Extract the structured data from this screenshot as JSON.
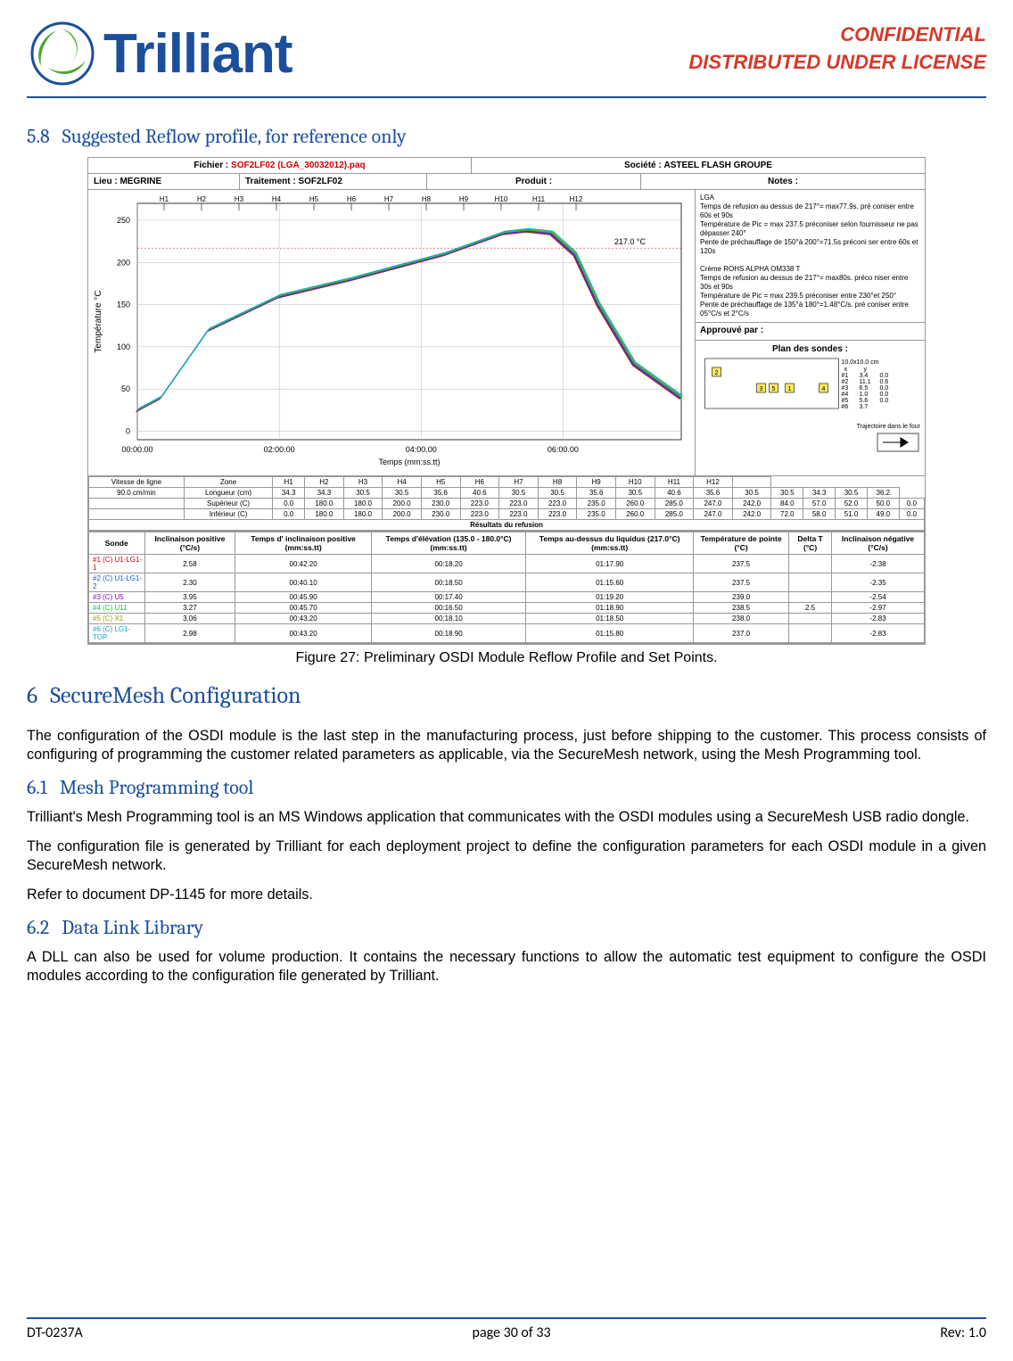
{
  "header": {
    "brand": "Trilliant",
    "conf1": "CONFIDENTIAL",
    "conf2": "DISTRIBUTED UNDER LICENSE"
  },
  "section58": {
    "num": "5.8",
    "title": "Suggested Reflow profile, for reference only"
  },
  "figcaption": "Figure 27: Preliminary OSDI Module Reflow Profile and Set Points.",
  "section6": {
    "num": "6",
    "title": "SecureMesh Configuration"
  },
  "p6": "The configuration of the OSDI module is the last step in the manufacturing process, just before shipping to the customer. This process consists of configuring of programming the customer related parameters as applicable, via the SecureMesh network, using the Mesh Programming tool.",
  "section61": {
    "num": "6.1",
    "title": "Mesh Programming tool"
  },
  "p61a": "Trilliant's Mesh Programming tool is an MS Windows application that communicates with the OSDI modules using a SecureMesh USB radio dongle.",
  "p61b": "The configuration file is generated by Trilliant for each deployment project to define the configuration parameters for each OSDI module in a given SecureMesh network.",
  "p61c": "Refer to document DP-1145 for more details.",
  "section62": {
    "num": "6.2",
    "title": "Data Link Library"
  },
  "p62": "A DLL can also be used for volume production. It contains the necessary functions to allow the automatic test equipment to configure the OSDI modules according to the configuration file generated by Trilliant.",
  "footer": {
    "doc": "DT-0237A",
    "page": "page 30 of 33",
    "rev": "Rev: 1.0"
  },
  "chart_data": {
    "type": "line",
    "title_row1": {
      "fichier_label": "Fichier :",
      "fichier": "SOF2LF02 (LGA_30032012).paq",
      "societe_label": "Société :",
      "societe": "ASTEEL FLASH GROUPE"
    },
    "title_row2": {
      "lieu_label": "Lieu :",
      "lieu": "MEGRINE",
      "trait_label": "Traitement :",
      "trait": "SOF2LF02",
      "produit_label": "Produit :",
      "produit": "",
      "notes_label": "Notes :"
    },
    "ylabel": "Température °C",
    "xlabel": "Temps (mm:ss.tt)",
    "y_ticks": [
      0,
      50,
      100,
      150,
      200,
      250
    ],
    "x_ticks": [
      "00:00.00",
      "02:00.00",
      "04:00.00",
      "06:00.00"
    ],
    "zones": [
      "H1",
      "H2",
      "H3",
      "H4",
      "H5",
      "H6",
      "H7",
      "H8",
      "H9",
      "H10",
      "H11",
      "H12"
    ],
    "annotation": "217.0 °C",
    "notes_text": [
      "LGA",
      "Temps de refusion au dessus de 217°= max77.9s. pré coniser entre 60s et 90s",
      "Température de Pic = max 237.5 préconiser selon fournisseur ne pas dépasser 240°",
      "Pente de préchauffage de 150°à 200°=71.5s préconi ser entre 60s et 120s",
      "",
      "Crème ROHS ALPHA OM338 T",
      "Temps de refusion au dessus de 217°= max80s. préco niser entre 30s et 90s",
      "Température de Pic = max 239.5 préconiser entre 230°et 250°",
      "Pente de préchauffage de 135°à 180°=1.48°C/s. pré coniser entre 05°C/s et 2°C/s"
    ],
    "approve_label": "Approuvé par :",
    "plan_label": "Plan des sondes :",
    "plan_dim": "10.0x10.0 cm",
    "plan_table": [
      [
        "#1",
        "3.4",
        "0.0"
      ],
      [
        "#2",
        "11.1",
        "0.6"
      ],
      [
        "#3",
        "6.5",
        "0.0"
      ],
      [
        "#4",
        "1.0",
        "0.0"
      ],
      [
        "#5",
        "5.6",
        "0.0"
      ],
      [
        "#6",
        "3.7",
        ""
      ]
    ],
    "traj_label": "Trajectoire dans le four",
    "series": [
      {
        "name": "#1 (C) U1-LG1-1",
        "color": "#d40000"
      },
      {
        "name": "#2 (C) U1-LG1-2",
        "color": "#0066d4"
      },
      {
        "name": "#3 (C) U5",
        "color": "#9000d4"
      },
      {
        "name": "#4 (C) U11",
        "color": "#00d42a"
      },
      {
        "name": "#5 (C) X1",
        "color": "#9aa000"
      },
      {
        "name": "#6 (C) LG1-TOP",
        "color": "#00b0d4"
      }
    ],
    "profile_x": [
      0,
      20,
      60,
      120,
      180,
      220,
      260,
      290,
      310,
      330,
      350,
      370,
      390,
      420,
      460
    ],
    "profile_y": [
      25,
      40,
      120,
      160,
      180,
      195,
      210,
      225,
      235,
      238,
      235,
      210,
      150,
      80,
      40
    ],
    "zone_table": {
      "header": [
        "Vitesse de ligne",
        "Zone",
        "H1",
        "H2",
        "H3",
        "H4",
        "H5",
        "H6",
        "H7",
        "H8",
        "H9",
        "H10",
        "H11",
        "H12",
        ""
      ],
      "rows": [
        [
          "90.0 cm/min",
          "Longueur (cm)",
          "34.3",
          "34.3",
          "30.5",
          "30.5",
          "35.6",
          "40.6",
          "30.5",
          "30.5",
          "35.6",
          "30.5",
          "40.6",
          "35.6",
          "30.5",
          "30.5",
          "34.3",
          "30.5",
          "36.2"
        ],
        [
          "",
          "Supérieur (C)",
          "0.0",
          "180.0",
          "180.0",
          "200.0",
          "230.0",
          "223.0",
          "223.0",
          "223.0",
          "235.0",
          "260.0",
          "285.0",
          "247.0",
          "242.0",
          "84.0",
          "57.0",
          "52.0",
          "50.0",
          "0.0"
        ],
        [
          "",
          "Inférieur (C)",
          "0.0",
          "180.0",
          "180.0",
          "200.0",
          "230.0",
          "223.0",
          "223.0",
          "223.0",
          "235.0",
          "260.0",
          "285.0",
          "247.0",
          "242.0",
          "72.0",
          "58.0",
          "51.0",
          "49.0",
          "0.0"
        ]
      ],
      "results_title": "Résultats du refusion"
    },
    "results": {
      "headers": [
        "Sonde",
        "Inclinaison positive (°C/s)",
        "Temps d' inclinaison positive (mm:ss.tt)",
        "Temps d'élévation (135.0 - 180.0°C) (mm:ss.tt)",
        "Temps au-dessus du liquidus (217.0°C) (mm:ss.tt)",
        "Température de pointe (°C)",
        "Delta T (°C)",
        "Inclinaison négative (°C/s)"
      ],
      "rows": [
        [
          "#1 (C) U1-LG1-1",
          "2.58",
          "00:42.20",
          "00:18.20",
          "01:17.90",
          "237.5",
          "",
          "-2.38"
        ],
        [
          "#2 (C) U1-LG1-2",
          "2.30",
          "00:40.10",
          "00:18.50",
          "01:15.60",
          "237.5",
          "",
          "-2.35"
        ],
        [
          "#3 (C) U5",
          "3.95",
          "00:45.90",
          "00:17.40",
          "01:19.20",
          "239.0",
          "",
          "-2.54"
        ],
        [
          "#4 (C) U11",
          "3.27",
          "00:45.70",
          "00:16.50",
          "01:18.90",
          "238.5",
          "2.5",
          "-2.97"
        ],
        [
          "#5 (C) X1",
          "3.06",
          "00:43.20",
          "00:18.10",
          "01:18.50",
          "238.0",
          "",
          "-2.83"
        ],
        [
          "#6 (C) LG1-TOP",
          "2.98",
          "00:43.20",
          "00:18.90",
          "01:15.80",
          "237.0",
          "",
          "-2.83"
        ]
      ]
    }
  }
}
